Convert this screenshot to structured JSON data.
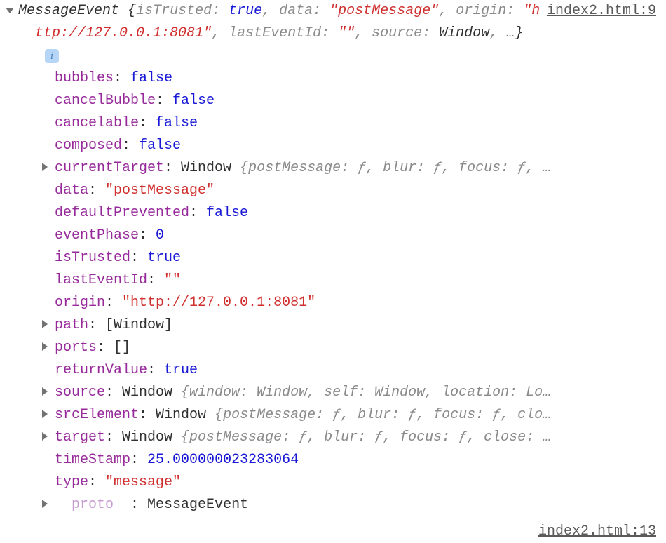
{
  "sourceTop": "index2.html:9",
  "sourceBottom": "index2.html:13",
  "header": {
    "className": "MessageEvent",
    "isTrustedKey": "isTrusted",
    "isTrustedVal": "true",
    "dataKey": "data",
    "dataVal": "\"postMessage\"",
    "originKey": "origin",
    "originVal": "\"http://127.0.0.1:8081\"",
    "lastEventIdKey": "lastEventId",
    "lastEventIdVal": "\"\"",
    "sourceKey": "source",
    "sourceVal": "Window",
    "ellipsis": "…"
  },
  "infoBadge": "i",
  "props": {
    "bubbles": {
      "k": "bubbles",
      "v": "false",
      "t": "bool"
    },
    "cancelBubble": {
      "k": "cancelBubble",
      "v": "false",
      "t": "bool"
    },
    "cancelable": {
      "k": "cancelable",
      "v": "false",
      "t": "bool"
    },
    "composed": {
      "k": "composed",
      "v": "false",
      "t": "bool"
    },
    "currentTarget": {
      "k": "currentTarget",
      "pre": "Window ",
      "body": "{postMessage: ƒ, blur: ƒ, focus: ƒ, …"
    },
    "data": {
      "k": "data",
      "v": "\"postMessage\"",
      "t": "str"
    },
    "defaultPrevented": {
      "k": "defaultPrevented",
      "v": "false",
      "t": "bool"
    },
    "eventPhase": {
      "k": "eventPhase",
      "v": "0",
      "t": "num"
    },
    "isTrusted": {
      "k": "isTrusted",
      "v": "true",
      "t": "bool"
    },
    "lastEventId": {
      "k": "lastEventId",
      "v": "\"\"",
      "t": "str"
    },
    "origin": {
      "k": "origin",
      "v": "\"http://127.0.0.1:8081\"",
      "t": "str"
    },
    "path": {
      "k": "path",
      "v": "[Window]",
      "t": "obj"
    },
    "ports": {
      "k": "ports",
      "v": "[]",
      "t": "obj"
    },
    "returnValue": {
      "k": "returnValue",
      "v": "true",
      "t": "bool"
    },
    "source": {
      "k": "source",
      "pre": "Window ",
      "body": "{window: Window, self: Window, location: Lo…"
    },
    "srcElement": {
      "k": "srcElement",
      "pre": "Window ",
      "body": "{postMessage: ƒ, blur: ƒ, focus: ƒ, clo…"
    },
    "target": {
      "k": "target",
      "pre": "Window ",
      "body": "{postMessage: ƒ, blur: ƒ, focus: ƒ, close: …"
    },
    "timeStamp": {
      "k": "timeStamp",
      "v": "25.000000023283064",
      "t": "num"
    },
    "type": {
      "k": "type",
      "v": "\"message\"",
      "t": "str"
    },
    "proto": {
      "k": "__proto__",
      "v": "MessageEvent",
      "t": "obj"
    }
  }
}
